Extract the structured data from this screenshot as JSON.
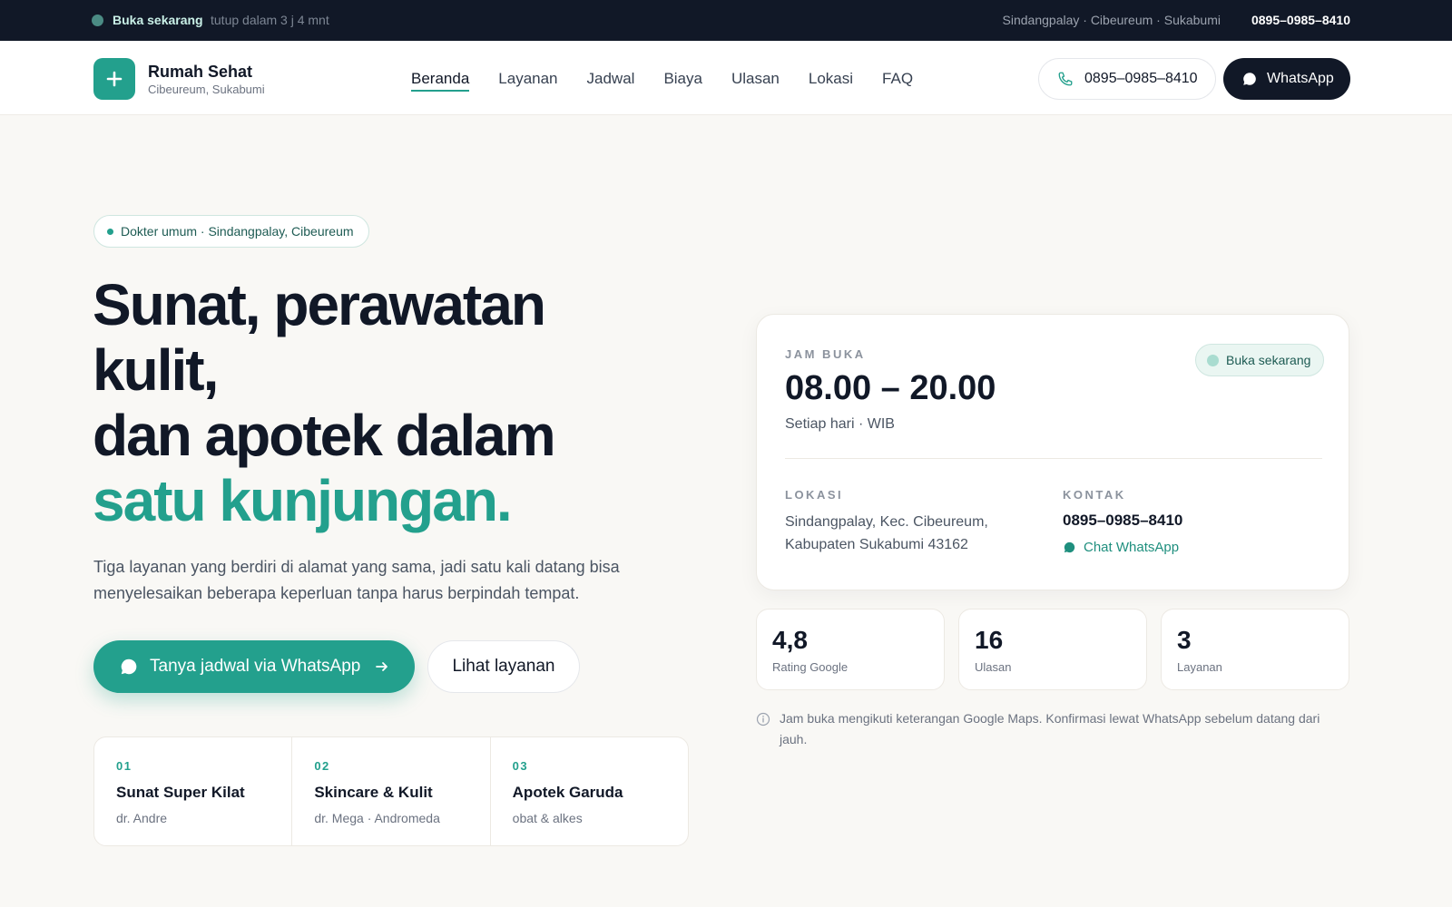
{
  "topbar": {
    "open_label": "Buka sekarang",
    "close_time": "tutup dalam 3 j 4 mnt",
    "location": "Sindangpalay · Cibeureum · Sukabumi",
    "phone": "0895–0985–8410"
  },
  "header": {
    "brand_name": "Rumah Sehat",
    "brand_sub": "Cibeureum, Sukabumi",
    "nav": [
      "Beranda",
      "Layanan",
      "Jadwal",
      "Biaya",
      "Ulasan",
      "Lokasi",
      "FAQ"
    ],
    "active_nav": "Beranda",
    "phone_button": "0895–0985–8410",
    "whatsapp_button": "WhatsApp"
  },
  "hero": {
    "pill": "Dokter umum · Sindangpalay, Cibeureum",
    "headline_lines": [
      "Sunat, perawatan",
      "kulit,",
      "dan apotek dalam"
    ],
    "headline_accent": "satu kunjungan.",
    "lede": "Tiga layanan yang berdiri di alamat yang sama, jadi satu kali datang bisa menyelesaikan beberapa keperluan tanpa harus berpindah tempat.",
    "primary_cta": "Tanya jadwal via WhatsApp",
    "secondary_cta": "Lihat layanan",
    "services": [
      {
        "num": "01",
        "name": "Sunat Super Kilat",
        "sub": "dr. Andre"
      },
      {
        "num": "02",
        "name": "Skincare & Kulit",
        "sub": "dr. Mega · Andromeda"
      },
      {
        "num": "03",
        "name": "Apotek Garuda",
        "sub": "obat & alkes"
      }
    ]
  },
  "card": {
    "hours_label": "JAM BUKA",
    "hours": "08.00 – 20.00",
    "hours_sub": "Setiap hari · WIB",
    "badge": "Buka sekarang",
    "location_label": "LOKASI",
    "location_text": "Sindangpalay, Kec. Cibeureum, Kabupaten Sukabumi 43162",
    "contact_label": "KONTAK",
    "contact_phone": "0895–0985–8410",
    "contact_wa": "Chat WhatsApp"
  },
  "stats": [
    {
      "value": "4,8",
      "label": "Rating Google"
    },
    {
      "value": "16",
      "label": "Ulasan"
    },
    {
      "value": "3",
      "label": "Layanan"
    }
  ],
  "note": "Jam buka mengikuti keterangan Google Maps. Konfirmasi lewat WhatsApp sebelum datang dari jauh.",
  "colors": {
    "accent": "#23a08d",
    "dark": "#111827",
    "background": "#f9f8f5"
  },
  "icons": [
    "plus-icon",
    "phone-icon",
    "whatsapp-icon",
    "arrow-right-icon",
    "info-icon"
  ]
}
